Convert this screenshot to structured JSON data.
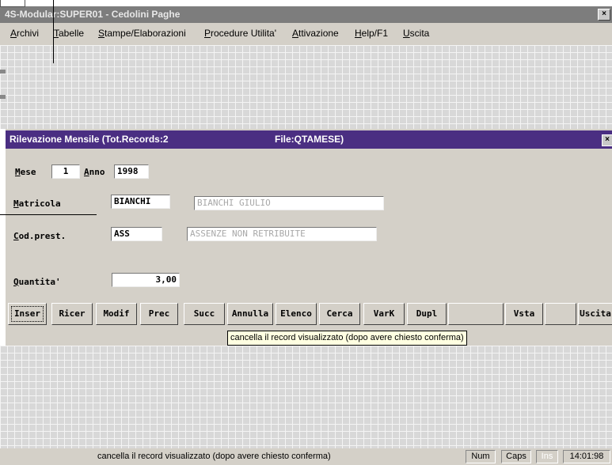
{
  "window": {
    "title": "4S-Modular:SUPER01 - Cedolini Paghe",
    "close_symbol": "×"
  },
  "menu": {
    "items": [
      "Archivi",
      "Tabelle",
      "Stampe/Elaborazioni",
      "Procedure Utilita'",
      "Attivazione",
      "Help/F1",
      "Uscita"
    ]
  },
  "dialog": {
    "title": "Rilevazione Mensile (Tot.Records:2",
    "file": "File:QTAMESE)",
    "close_symbol": "×",
    "mese_label": "Mese",
    "mese_value": "1",
    "anno_label": "Anno",
    "anno_value": "1998",
    "matricola_label": "Matricola",
    "matricola_value": "BIANCHI",
    "matricola_name": "BIANCHI GIULIO",
    "cod_label": "Cod.prest.",
    "cod_value": "ASS",
    "cod_desc": "ASSENZE NON RETRIBUITE",
    "quantita_label": "Quantita'",
    "quantita_value": "3,00"
  },
  "buttons": {
    "inser": "Inser",
    "ricer": "Ricer",
    "modif": "Modif",
    "prec": "Prec",
    "succ": "Succ",
    "annulla": "Annulla",
    "elenco": "Elenco",
    "cerca": "Cerca",
    "vark": "VarK",
    "dupl": "Dupl",
    "vista": "Vsta",
    "uscita": "Uscita"
  },
  "tooltip": "cancella il record visualizzato (dopo avere chiesto conferma)",
  "status": {
    "message": "cancella il record visualizzato (dopo avere chiesto conferma)",
    "num": "Num",
    "caps": "Caps",
    "ins": "Ins",
    "time": "14:01:98"
  },
  "colors": {
    "dialog_title_bg": "#4a2e82",
    "window_title_bg": "#7d7d7d",
    "tooltip_bg": "#ffffe1"
  }
}
